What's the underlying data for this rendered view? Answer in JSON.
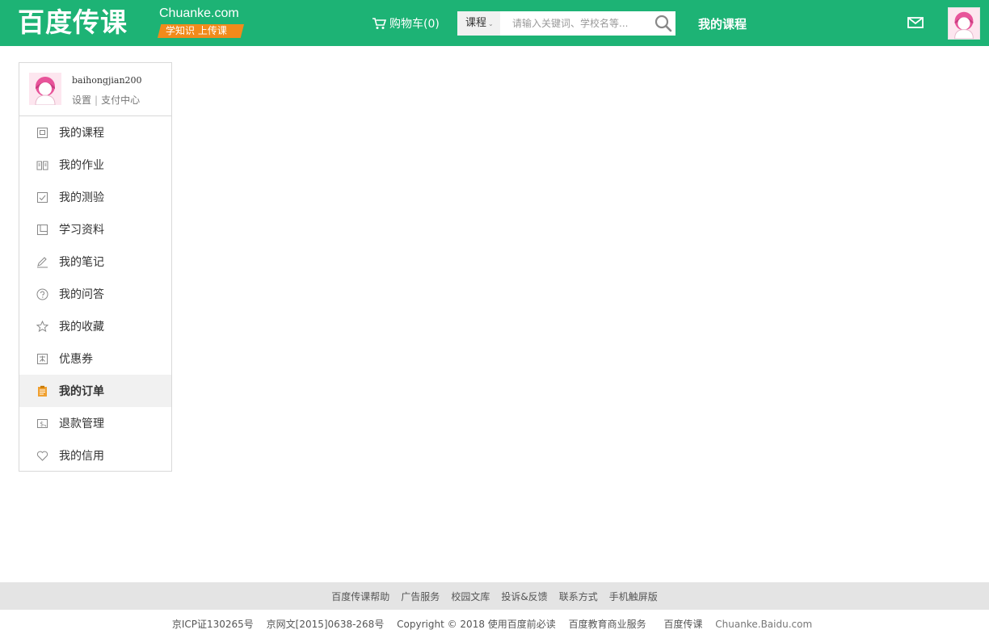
{
  "header": {
    "logo_cn": "百度传课",
    "logo_en": "Chuanke.com",
    "slogan": "学知识 上传课",
    "cart_label": "购物车(0)",
    "search_category": "课程",
    "search_placeholder": "请输入关键词、学校名等...",
    "my_course": "我的课程",
    "icons": {
      "cart": "cart-icon",
      "search": "search-icon",
      "mail": "mail-icon",
      "caret": "chevron-down-icon"
    },
    "colors": {
      "brand": "#1db375",
      "slogan_bg": "#f28a1b"
    }
  },
  "sidebar": {
    "username": "baihongjian200",
    "settings": "设置",
    "pay_center": "支付中心",
    "separator": "|",
    "items": [
      {
        "label": "我的课程",
        "icon": "course-icon"
      },
      {
        "label": "我的作业",
        "icon": "homework-book-icon"
      },
      {
        "label": "我的测验",
        "icon": "quiz-icon"
      },
      {
        "label": "学习资料",
        "icon": "material-icon"
      },
      {
        "label": "我的笔记",
        "icon": "pen-icon"
      },
      {
        "label": "我的问答",
        "icon": "question-icon"
      },
      {
        "label": "我的收藏",
        "icon": "star-icon"
      },
      {
        "label": "优惠券",
        "icon": "coupon-icon"
      },
      {
        "label": "我的订单",
        "icon": "order-icon",
        "active": true
      },
      {
        "label": "退款管理",
        "icon": "refund-icon"
      },
      {
        "label": "我的信用",
        "icon": "heart-icon"
      }
    ]
  },
  "footer": {
    "links": [
      "百度传课帮助",
      "广告服务",
      "校园文库",
      "投诉&反馈",
      "联系方式",
      "手机触屏版"
    ],
    "icp": "京ICP证130265号",
    "net_license": "京网文[2015]0638-268号",
    "copyright": "Copyright © 2018 使用百度前必读",
    "biz": "百度教育商业服务",
    "brand": "百度传课",
    "domain": "Chuanke.Baidu.com"
  }
}
